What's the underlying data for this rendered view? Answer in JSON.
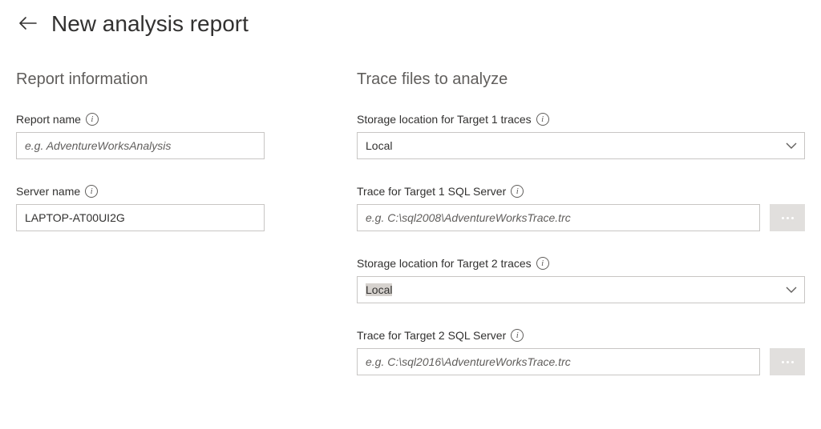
{
  "header": {
    "title": "New analysis report"
  },
  "leftSection": {
    "heading": "Report information",
    "reportName": {
      "label": "Report name",
      "placeholder": "e.g. AdventureWorksAnalysis",
      "value": ""
    },
    "serverName": {
      "label": "Server name",
      "value": "LAPTOP-AT00UI2G"
    }
  },
  "rightSection": {
    "heading": "Trace files to analyze",
    "storage1": {
      "label": "Storage location for Target 1 traces",
      "value": "Local"
    },
    "trace1": {
      "label": "Trace for Target 1 SQL Server",
      "placeholder": "e.g. C:\\sql2008\\AdventureWorksTrace.trc",
      "value": ""
    },
    "storage2": {
      "label": "Storage location for Target 2 traces",
      "value": "Local"
    },
    "trace2": {
      "label": "Trace for Target 2 SQL Server",
      "placeholder": "e.g. C:\\sql2016\\AdventureWorksTrace.trc",
      "value": ""
    }
  }
}
